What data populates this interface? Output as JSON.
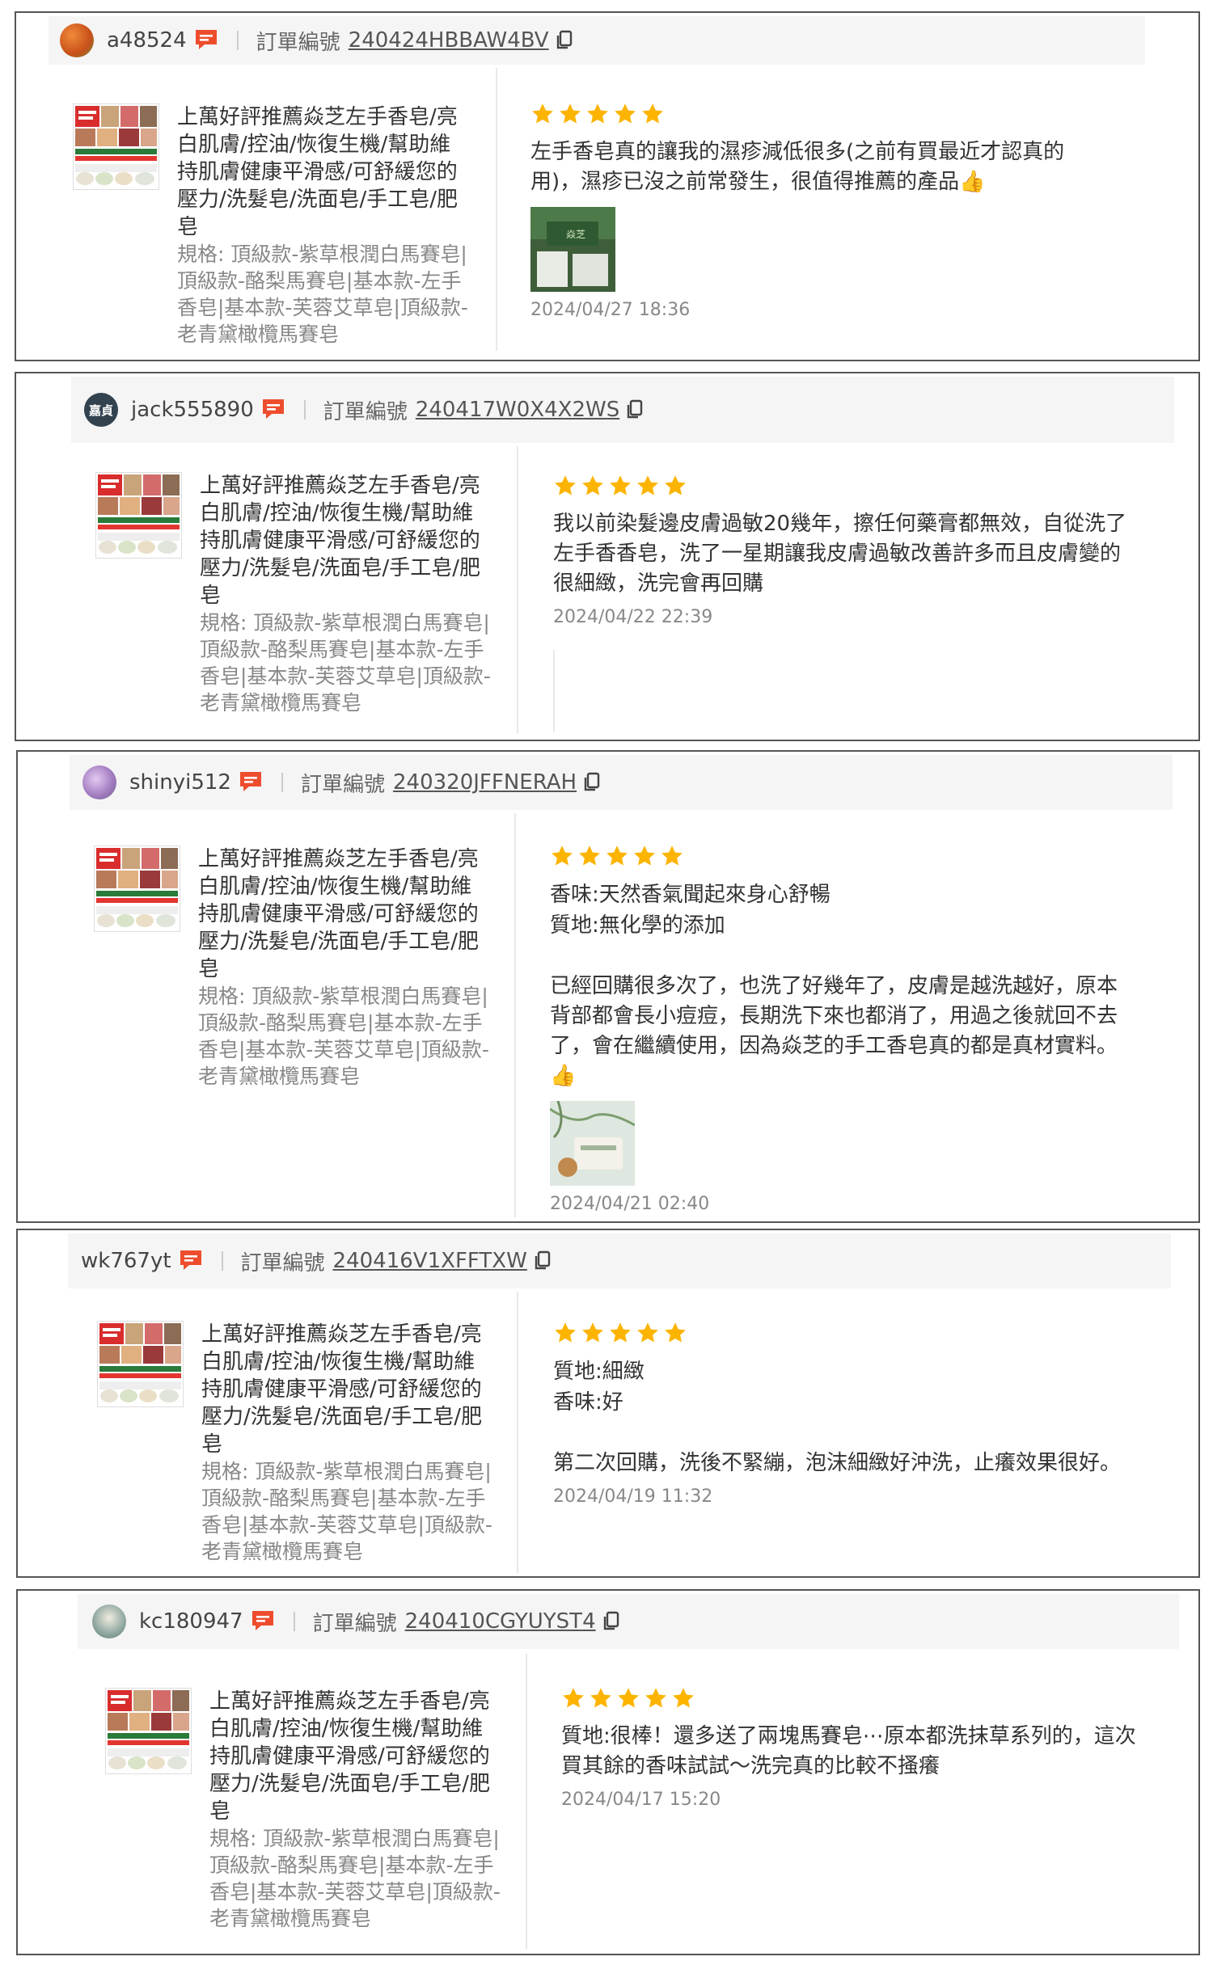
{
  "order_label": "訂單編號",
  "product": {
    "name": "上萬好評推薦焱芝左手香皂/亮白肌膚/控油/恢復生機/幫助維持肌膚健康平滑感/可舒緩您的壓力/洗髮皂/洗面皂/手工皂/肥皂",
    "variation": "規格: 頂級款-紫草根潤白馬賽皂|頂級款-酪梨馬賽皂|基本款-左手香皂|基本款-芙蓉艾草皂|頂級款-老青黛橄欖馬賽皂"
  },
  "reviews": [
    {
      "username": "a48524",
      "order_no": "240424HBBAW4BV",
      "rating": 5,
      "text": "左手香皂真的讓我的濕疹減低很多(之前有買最近才認真的用)，濕疹已沒之前常發生，很值得推薦的產品👍",
      "date": "2024/04/27 18:36"
    },
    {
      "username": "jack555890",
      "avatar_text": "嘉貞",
      "order_no": "240417W0X4X2WS",
      "rating": 5,
      "text": "我以前染髮邊皮膚過敏20幾年，擦任何藥膏都無效，自從洗了左手香香皂，洗了一星期讓我皮膚過敏改善許多而且皮膚變的很細緻，洗完會再回購",
      "date": "2024/04/22 22:39"
    },
    {
      "username": "shinyi512",
      "order_no": "240320JFFNERAH",
      "rating": 5,
      "attr1": "香味:天然香氣聞起來身心舒暢",
      "attr2": "質地:無化學的添加",
      "text": "已經回購很多次了，也洗了好幾年了，皮膚是越洗越好，原本背部都會長小痘痘，長期洗下來也都消了，用過之後就回不去了，會在繼續使用，因為焱芝的手工香皂真的都是真材實料。👍",
      "date": "2024/04/21 02:40"
    },
    {
      "username": "wk767yt",
      "order_no": "240416V1XFFTXW",
      "rating": 5,
      "attr1": "質地:細緻",
      "attr2": "香味:好",
      "text": "第二次回購，洗後不緊繃，泡沫細緻好沖洗，止癢效果很好。",
      "date": "2024/04/19 11:32"
    },
    {
      "username": "kc180947",
      "order_no": "240410CGYUYST4",
      "rating": 5,
      "text": "質地:很棒！還多送了兩塊馬賽皂⋯原本都洗抹草系列的，這次買其餘的香味試試～洗完真的比較不搔癢",
      "date": "2024/04/17 15:20"
    }
  ],
  "colors": {
    "star": "#fcb400",
    "chat_icon": "#ee4d2d",
    "header_bg": "#f5f5f5"
  }
}
